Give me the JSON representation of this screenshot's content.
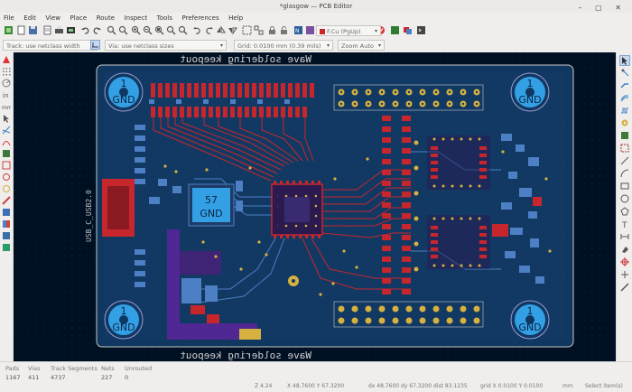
{
  "window": {
    "title": "*glasgow — PCB Editor"
  },
  "menu": [
    "File",
    "Edit",
    "View",
    "Place",
    "Route",
    "Inspect",
    "Tools",
    "Preferences",
    "Help"
  ],
  "options": {
    "track": "Track: use netclass width",
    "via": "Via: use netclass sizes",
    "grid": "Grid: 0.0100 mm (0.39 mils)",
    "zoom": "Zoom Auto",
    "layer": "F.Cu (PgUp)"
  },
  "board": {
    "keepout_top": "Wave soldering keepout",
    "keepout_bottom": "Wave soldering keepout",
    "mount_holes": [
      {
        "num": "1",
        "net": "GND"
      },
      {
        "num": "1",
        "net": "GND"
      },
      {
        "num": "1",
        "net": "GND"
      },
      {
        "num": "1",
        "net": "GND"
      }
    ],
    "chip_pad": {
      "num": "57",
      "net": "GND"
    },
    "usb_label": "USB_C_USB2.0"
  },
  "status": {
    "pads_label": "Pads",
    "pads": "1167",
    "vias_label": "Vias",
    "vias": "411",
    "tracks_label": "Track Segments",
    "tracks": "4737",
    "nets_label": "Nets",
    "nets": "227",
    "unrouted_label": "Unrouted",
    "unrouted": "0",
    "zoom": "Z 4.24",
    "xy": "X 48.7600  Y 67.3200",
    "dxy": "dx 48.7600  dy 67.3200  dist 83.1235",
    "grid": "grid X 0.0100  Y 0.0100",
    "units": "mm",
    "selection": "Select item(s)"
  },
  "colors": {
    "canvas_bg": "#001023",
    "front_copper": "#c8262d",
    "back_copper": "#4d7fc4",
    "via": "#d6b13f",
    "silkscreen": "#e8e8e8",
    "zone": "#4b1e7a"
  }
}
